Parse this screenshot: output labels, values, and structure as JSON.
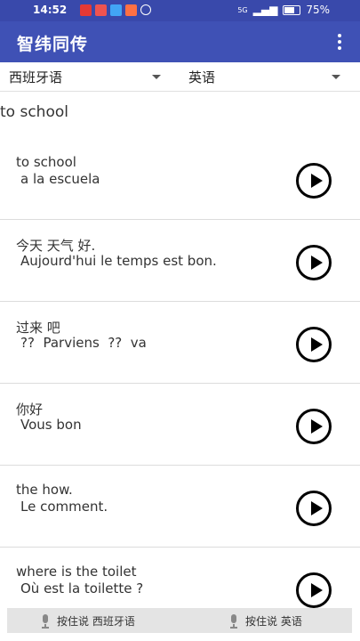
{
  "status": {
    "time": "14:52",
    "battery": "75%",
    "network": "5G",
    "colors": [
      "#e53935",
      "#ef5350",
      "#42a5f5",
      "#ff7043"
    ]
  },
  "app": {
    "title": "智纬同传",
    "menu_icon": "more-vert-icon"
  },
  "languages": {
    "source": "西班牙语",
    "target": "英语"
  },
  "input_text": "to school",
  "items": [
    {
      "src": "to school",
      "tgt": "a la escuela"
    },
    {
      "src": "今天 天气 好.",
      "tgt": "Aujourd'hui le temps est bon."
    },
    {
      "src": "过来 吧",
      "tgt": "??  Parviens  ??  va"
    },
    {
      "src": "你好",
      "tgt": "Vous bon"
    },
    {
      "src": "the how.",
      "tgt": "Le comment."
    },
    {
      "src": "where is the toilet",
      "tgt": "Où est la toilette ?"
    }
  ],
  "bottom": {
    "left": "按住说 西班牙语",
    "right": "按住说 英语"
  }
}
